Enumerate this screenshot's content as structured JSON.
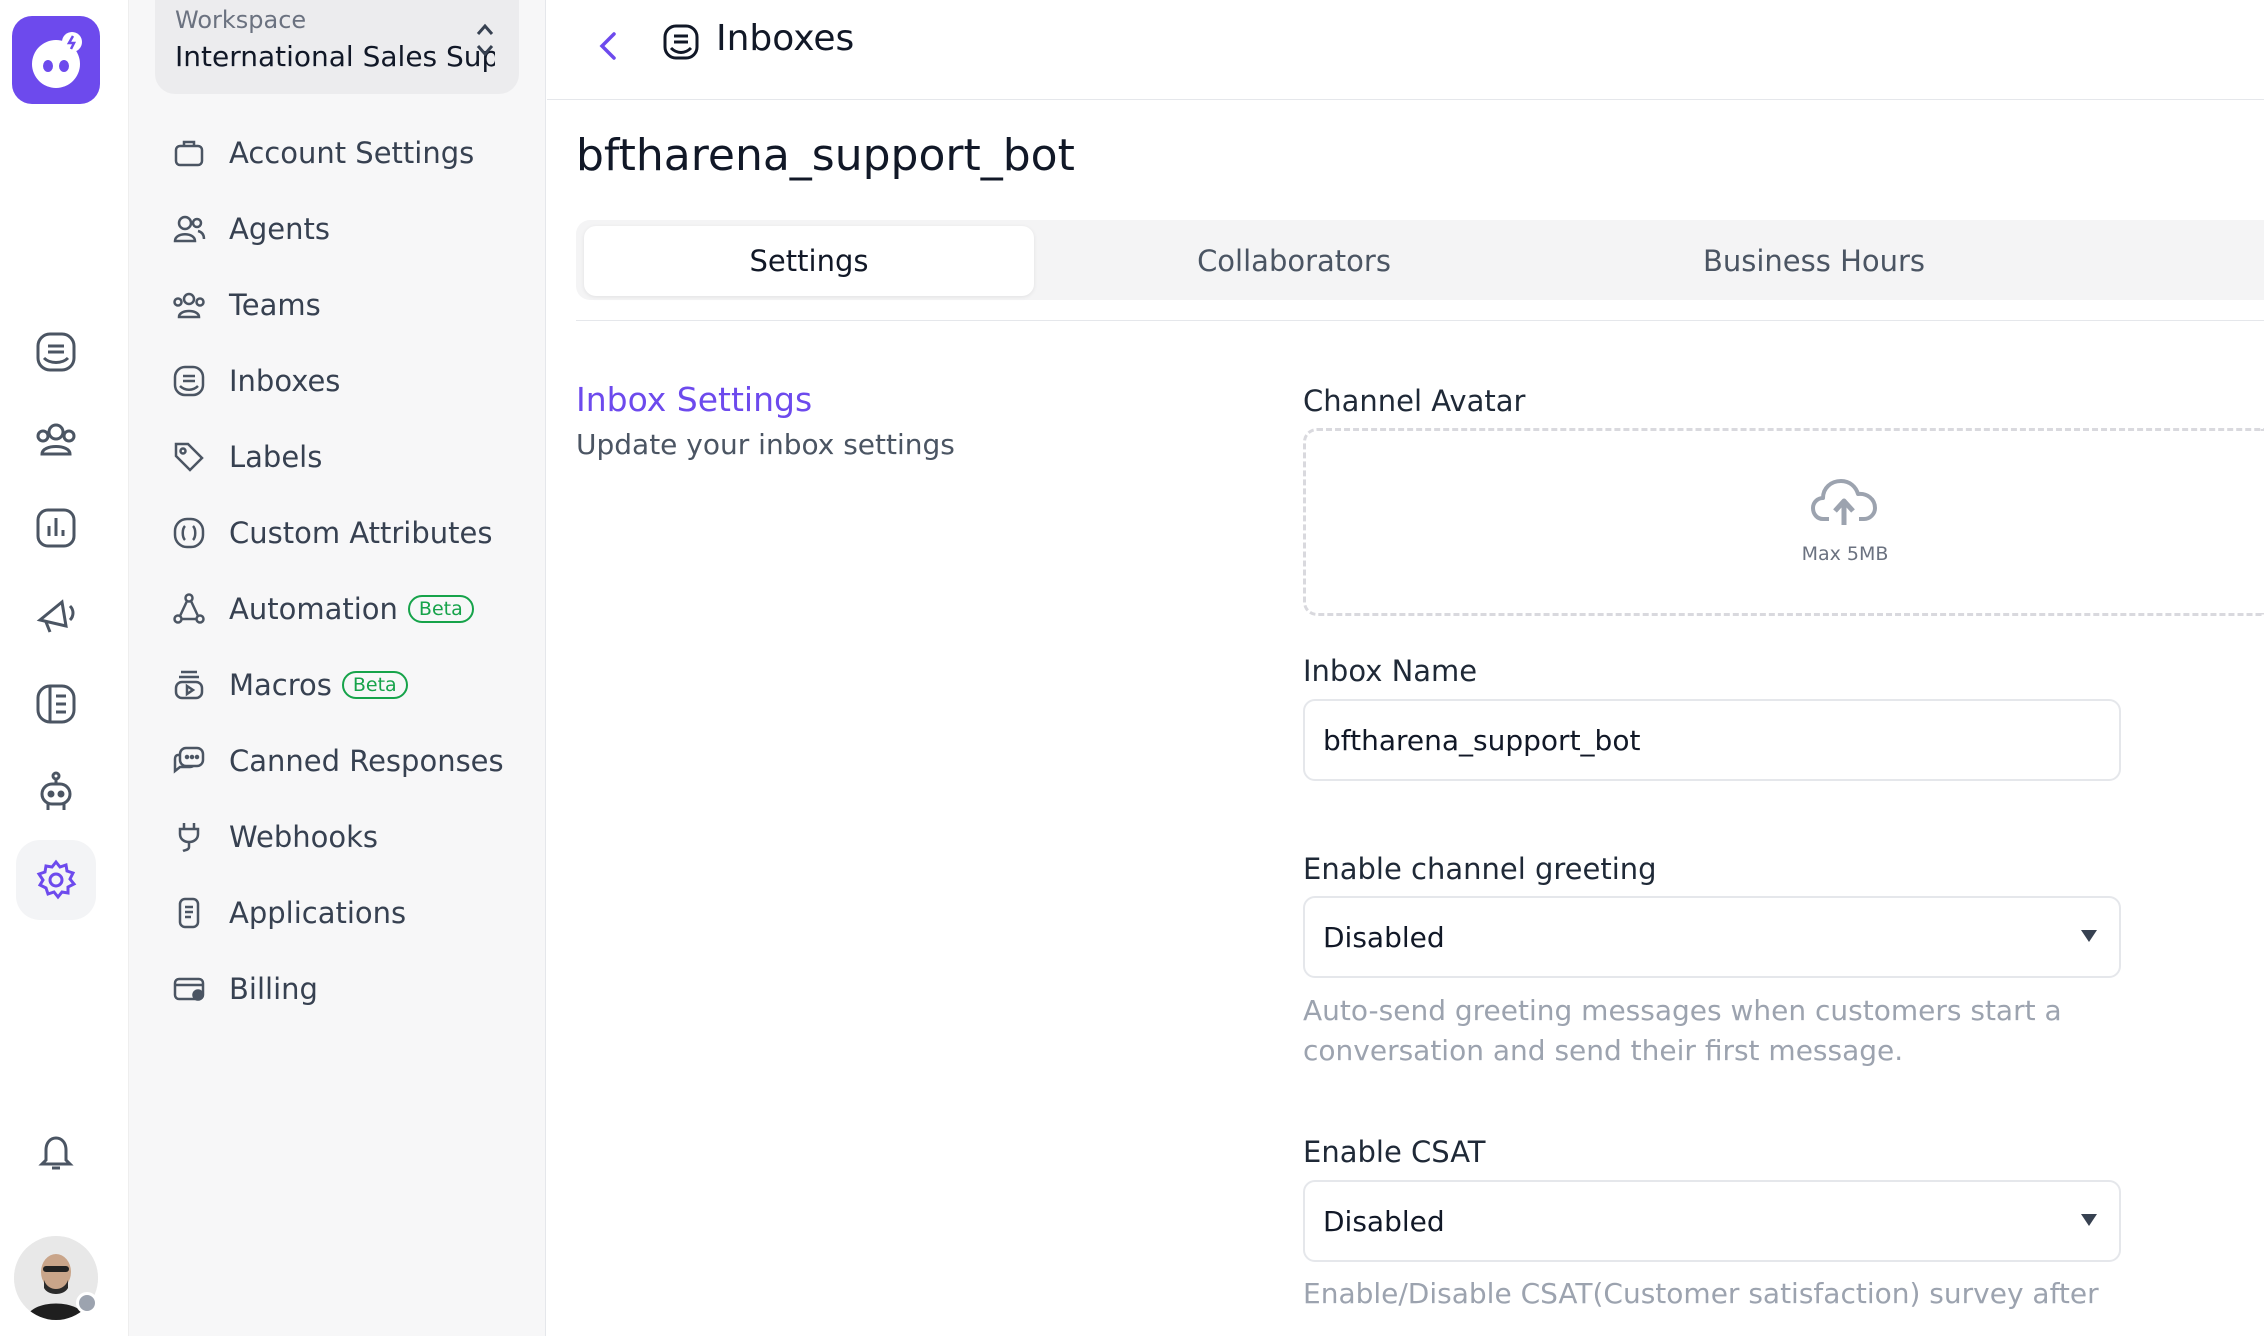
{
  "workspace": {
    "label": "Workspace",
    "name": "International Sales Sup..."
  },
  "settings_nav": [
    {
      "label": "Account Settings",
      "icon": "briefcase-icon"
    },
    {
      "label": "Agents",
      "icon": "people-icon"
    },
    {
      "label": "Teams",
      "icon": "team-icon"
    },
    {
      "label": "Inboxes",
      "icon": "inbox-icon"
    },
    {
      "label": "Labels",
      "icon": "tag-icon"
    },
    {
      "label": "Custom Attributes",
      "icon": "attribute-icon"
    },
    {
      "label": "Automation",
      "icon": "automation-icon",
      "badge": "Beta"
    },
    {
      "label": "Macros",
      "icon": "macro-icon",
      "badge": "Beta"
    },
    {
      "label": "Canned Responses",
      "icon": "chat-bubbles-icon"
    },
    {
      "label": "Webhooks",
      "icon": "plug-icon"
    },
    {
      "label": "Applications",
      "icon": "phone-app-icon"
    },
    {
      "label": "Billing",
      "icon": "wallet-icon"
    }
  ],
  "rail": {
    "items": [
      "conversations-icon",
      "contacts-icon",
      "reports-icon",
      "campaigns-icon",
      "help-center-icon",
      "bot-icon",
      "settings-icon"
    ],
    "active": "settings-icon",
    "bottom": [
      "notification-bell-icon",
      "user-avatar"
    ]
  },
  "header": {
    "back_icon": "chevron-left-icon",
    "icon": "inbox-icon",
    "title": "Inboxes"
  },
  "page": {
    "title": "bftharena_support_bot",
    "tabs": [
      {
        "label": "Settings",
        "active": true
      },
      {
        "label": "Collaborators",
        "active": false
      },
      {
        "label": "Business Hours",
        "active": false
      }
    ]
  },
  "section": {
    "title": "Inbox Settings",
    "description": "Update your inbox settings"
  },
  "form": {
    "avatar_label": "Channel Avatar",
    "avatar_hint": "Max 5MB",
    "inbox_name_label": "Inbox Name",
    "inbox_name_value": "bftharena_support_bot",
    "greeting_label": "Enable channel greeting",
    "greeting_value": "Disabled",
    "greeting_help": "Auto-send greeting messages when customers start a conversation and send their first message.",
    "csat_label": "Enable CSAT",
    "csat_value": "Disabled",
    "csat_help": "Enable/Disable CSAT(Customer satisfaction) survey after"
  },
  "colors": {
    "accent": "#6d4aed",
    "badge_green": "#16a34a",
    "sidebar_bg": "#f7f7f8"
  }
}
